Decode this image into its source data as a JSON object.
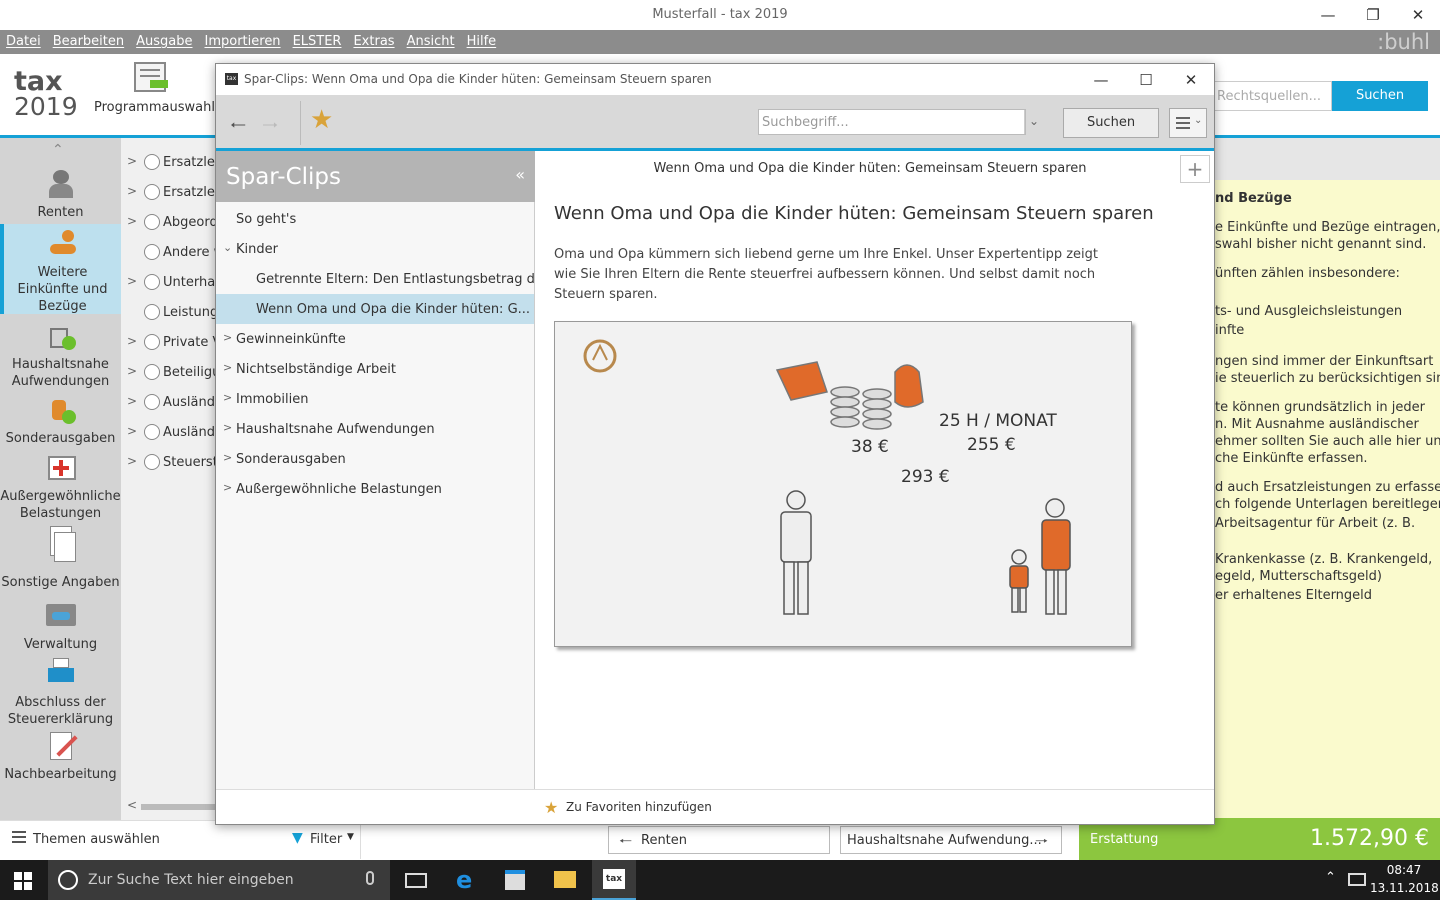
{
  "window": {
    "title": "Musterfall - tax 2019"
  },
  "menu": [
    "Datei",
    "Bearbeiten",
    "Ausgabe",
    "Importieren",
    "ELSTER",
    "Extras",
    "Ansicht",
    "Hilfe"
  ],
  "brand": ":buhl",
  "logo": {
    "line1": "tax",
    "line2": "2019"
  },
  "ribbon": {
    "program_label": "Programmauswahl",
    "search_placeholder": "Rechtsquellen...",
    "search_button": "Suchen"
  },
  "leftnav": [
    {
      "label": "Renten",
      "icon": "pensioner-icon"
    },
    {
      "label": "Weitere Einkünfte und Bezüge",
      "icon": "coins-hand-icon",
      "active": true
    },
    {
      "label": "Haushaltsnahe Aufwendungen",
      "icon": "household-icon"
    },
    {
      "label": "Sonderausgaben",
      "icon": "special-expenses-icon"
    },
    {
      "label": "Außergewöhnliche Belastungen",
      "icon": "first-aid-icon"
    },
    {
      "label": "Sonstige Angaben",
      "icon": "documents-icon"
    },
    {
      "label": "Verwaltung",
      "icon": "car-folder-icon"
    },
    {
      "label": "Abschluss der Steuererklärung",
      "icon": "printer-icon"
    },
    {
      "label": "Nachbearbeitung",
      "icon": "edit-document-icon"
    }
  ],
  "tree": [
    "Ersatzleis",
    "Ersatzleis",
    "Abgeord",
    "Andere w",
    "Unterhalt",
    "Leistunge",
    "Private V",
    "Beteiligu",
    "Ausländis",
    "Ausländis",
    "Steuerstu"
  ],
  "rightpanel": {
    "title": "nd Bezüge",
    "lines": [
      "e Einkünfte und Bezüge eintragen,",
      "swahl bisher nicht genannt sind.",
      "ünften zählen insbesondere:",
      "ts- und Ausgleichsleistungen",
      "infte",
      "ngen sind immer der Einkunftsart",
      "ie steuerlich zu berücksichtigen sind.",
      "te können grundsätzlich in jeder",
      "n. Mit Ausnahme ausländischer",
      "ehmer sollten Sie auch alle hier unter",
      "che Einkünfte erfassen.",
      "d auch Ersatzleistungen zu erfassen.",
      "ch folgende Unterlagen bereitlegen:",
      "Arbeitsagentur für Arbeit (z. B.",
      "Krankenkasse (z. B. Krankengeld,",
      "egeld, Mutterschaftsgeld)",
      "er erhaltenes Elterngeld"
    ]
  },
  "dialog": {
    "title": "Spar-Clips: Wenn Oma und Opa die Kinder hüten: Gemeinsam Steuern sparen",
    "search_placeholder": "Suchbegriff...",
    "search_button": "Suchen",
    "sidebar_title": "Spar-Clips",
    "items": [
      {
        "label": "So geht's",
        "level": 0,
        "chev": ""
      },
      {
        "label": "Kinder",
        "level": 0,
        "chev": "v"
      },
      {
        "label": "Getrennte Eltern: Den Entlastungsbetrag d...",
        "level": 1,
        "chev": ""
      },
      {
        "label": "Wenn Oma und Opa die Kinder hüten: G...",
        "level": 1,
        "chev": "",
        "selected": true
      },
      {
        "label": "Gewinneinkünfte",
        "level": 0,
        "chev": ">"
      },
      {
        "label": "Nichtselbständige Arbeit",
        "level": 0,
        "chev": ">"
      },
      {
        "label": "Immobilien",
        "level": 0,
        "chev": ">"
      },
      {
        "label": "Haushaltsnahe Aufwendungen",
        "level": 0,
        "chev": ">"
      },
      {
        "label": "Sonderausgaben",
        "level": 0,
        "chev": ">"
      },
      {
        "label": "Außergewöhnliche Belastungen",
        "level": 0,
        "chev": ">"
      }
    ],
    "caption": "Wenn Oma und Opa die Kinder hüten: Gemeinsam Steuern sparen",
    "heading": "Wenn Oma und Opa die Kinder hüten: Gemeinsam Steuern sparen",
    "intro": "Oma und Opa kümmern sich liebend gerne um Ihre Enkel. Unser Expertentipp zeigt wie Sie Ihren Eltern die Rente steuerfrei aufbessern können. Und selbst damit noch Steuern sparen.",
    "illustration": {
      "a": "25 H / MONAT",
      "b": "255 €",
      "c": "38 €",
      "d": "293 €"
    },
    "favorite": "Zu Favoriten hinzufügen"
  },
  "bottombar": {
    "themes": "Themen auswählen",
    "filter": "Filter",
    "prev": "Renten",
    "next": "Haushaltsnahe Aufwendung...",
    "result_label": "Erstattung",
    "result_value": "1.572,90 €"
  },
  "taskbar": {
    "search_placeholder": "Zur Suche Text hier eingeben",
    "time": "08:47",
    "date": "13.11.2018"
  },
  "colors": {
    "accent": "#15a1d6",
    "result_green": "#8cc63f",
    "panel_yellow": "#fafacd"
  }
}
